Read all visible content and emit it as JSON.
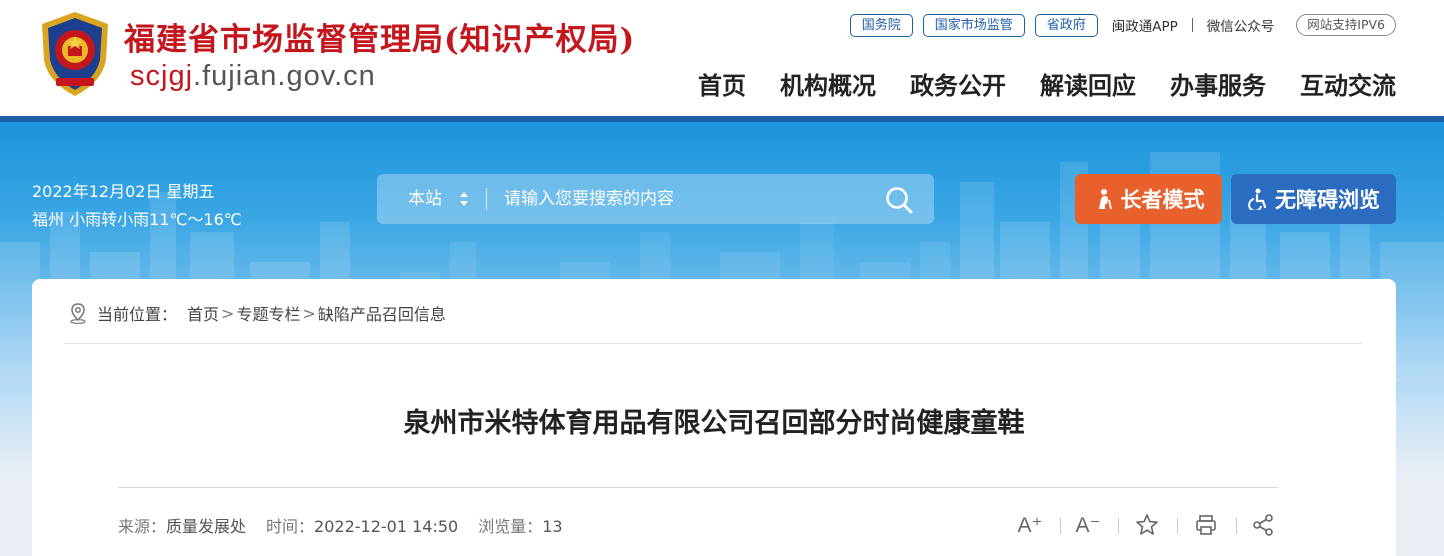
{
  "header": {
    "site_title": "福建省市场监督管理局(知识产权局)",
    "domain_highlight": "scjgj",
    "domain_rest": ".fujian.gov.cn",
    "emblem_icon": "police-emblem-icon",
    "top_links": {
      "guowuyuan": "国务院",
      "scjg": "国家市场监管",
      "shengzhengfu": "省政府",
      "app": "闽政通APP",
      "wechat": "微信公众号",
      "ipv6": "网站支持IPV6"
    },
    "nav": [
      "首页",
      "机构概况",
      "政务公开",
      "解读回应",
      "办事服务",
      "互动交流"
    ]
  },
  "banner": {
    "date": "2022年12月02日 星期五",
    "weather": "福州 小雨转小雨11℃～16℃",
    "search": {
      "scope": "本站",
      "placeholder": "请输入您要搜索的内容"
    },
    "elder_mode": "长者模式",
    "accessibility": "无障碍浏览"
  },
  "breadcrumb": {
    "label": "当前位置：",
    "items": [
      "首页",
      "专题专栏",
      "缺陷产品召回信息"
    ],
    "separator": ">"
  },
  "article": {
    "title": "泉州市米特体育用品有限公司召回部分时尚健康童鞋",
    "source_label": "来源：",
    "source": "质量发展处",
    "time_label": "时间：",
    "time": "2022-12-01 14:50",
    "views_label": "浏览量：",
    "views": "13"
  },
  "tools": {
    "font_larger": "A⁺",
    "font_smaller": "A⁻",
    "icons": [
      "font-increase-icon",
      "font-decrease-icon",
      "star-icon",
      "print-icon",
      "share-icon"
    ]
  },
  "colors": {
    "brand_red": "#c4171d",
    "brand_blue": "#1f5ea8",
    "elder_orange": "#e8612c",
    "access_blue": "#2c6cc0"
  }
}
